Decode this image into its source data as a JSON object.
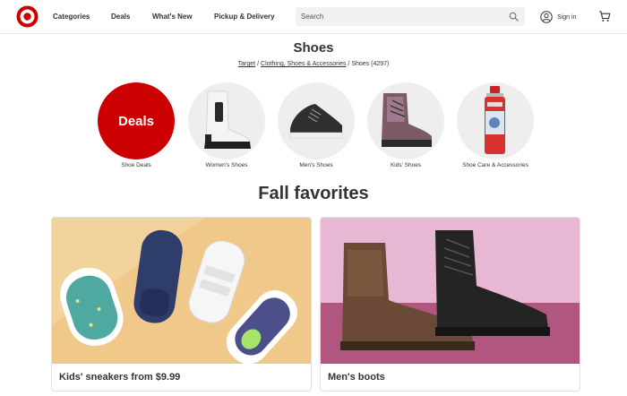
{
  "header": {
    "nav": [
      "Categories",
      "Deals",
      "What's New",
      "Pickup & Delivery"
    ],
    "search_placeholder": "Search",
    "signin_label": "Sign in"
  },
  "page": {
    "title": "Shoes",
    "breadcrumb": [
      {
        "label": "Target",
        "link": true
      },
      {
        "label": "Clothing, Shoes & Accessories",
        "link": true
      },
      {
        "label": "Shoes (4297)",
        "link": false
      }
    ]
  },
  "categories": [
    {
      "label": "Shoe Deals",
      "badge": "Deals"
    },
    {
      "label": "Women's Shoes"
    },
    {
      "label": "Men's Shoes"
    },
    {
      "label": "Kids' Shoes"
    },
    {
      "label": "Shoe Care & Accessories"
    }
  ],
  "section": {
    "title": "Fall favorites"
  },
  "cards": [
    {
      "label": "Kids' sneakers from $9.99"
    },
    {
      "label": "Men's boots"
    }
  ],
  "colors": {
    "brand_red": "#cc0000",
    "text": "#333333",
    "search_bg": "#f1f1f1",
    "card1_bg": "#f0c98a",
    "card2_bg": "#e7b7d3"
  },
  "icons": {
    "logo": "target-bullseye-icon",
    "search": "search-icon",
    "account": "account-circle-icon",
    "cart": "cart-icon"
  }
}
